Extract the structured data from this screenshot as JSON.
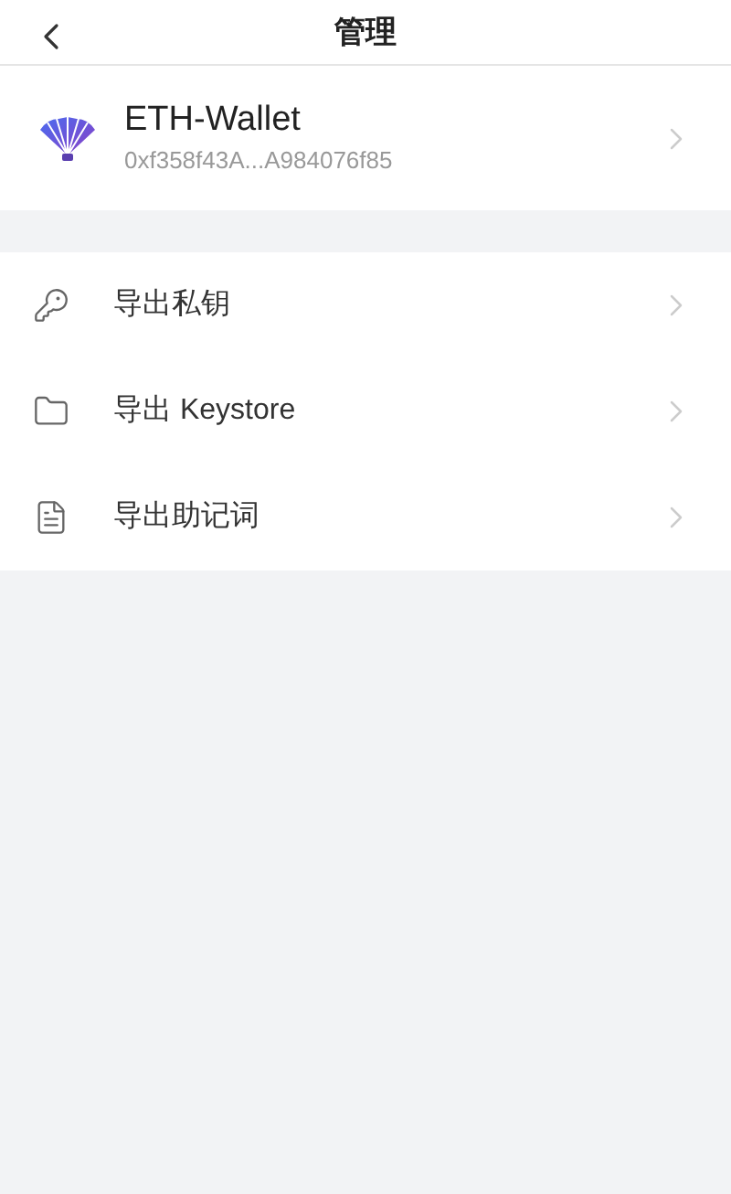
{
  "header": {
    "title": "管理"
  },
  "wallet": {
    "name": "ETH-Wallet",
    "address": "0xf358f43A...A984076f85"
  },
  "items": [
    {
      "kind": "key",
      "label": "导出私钥"
    },
    {
      "kind": "folder",
      "label": "导出 Keystore"
    },
    {
      "kind": "document",
      "label": "导出助记词"
    }
  ]
}
